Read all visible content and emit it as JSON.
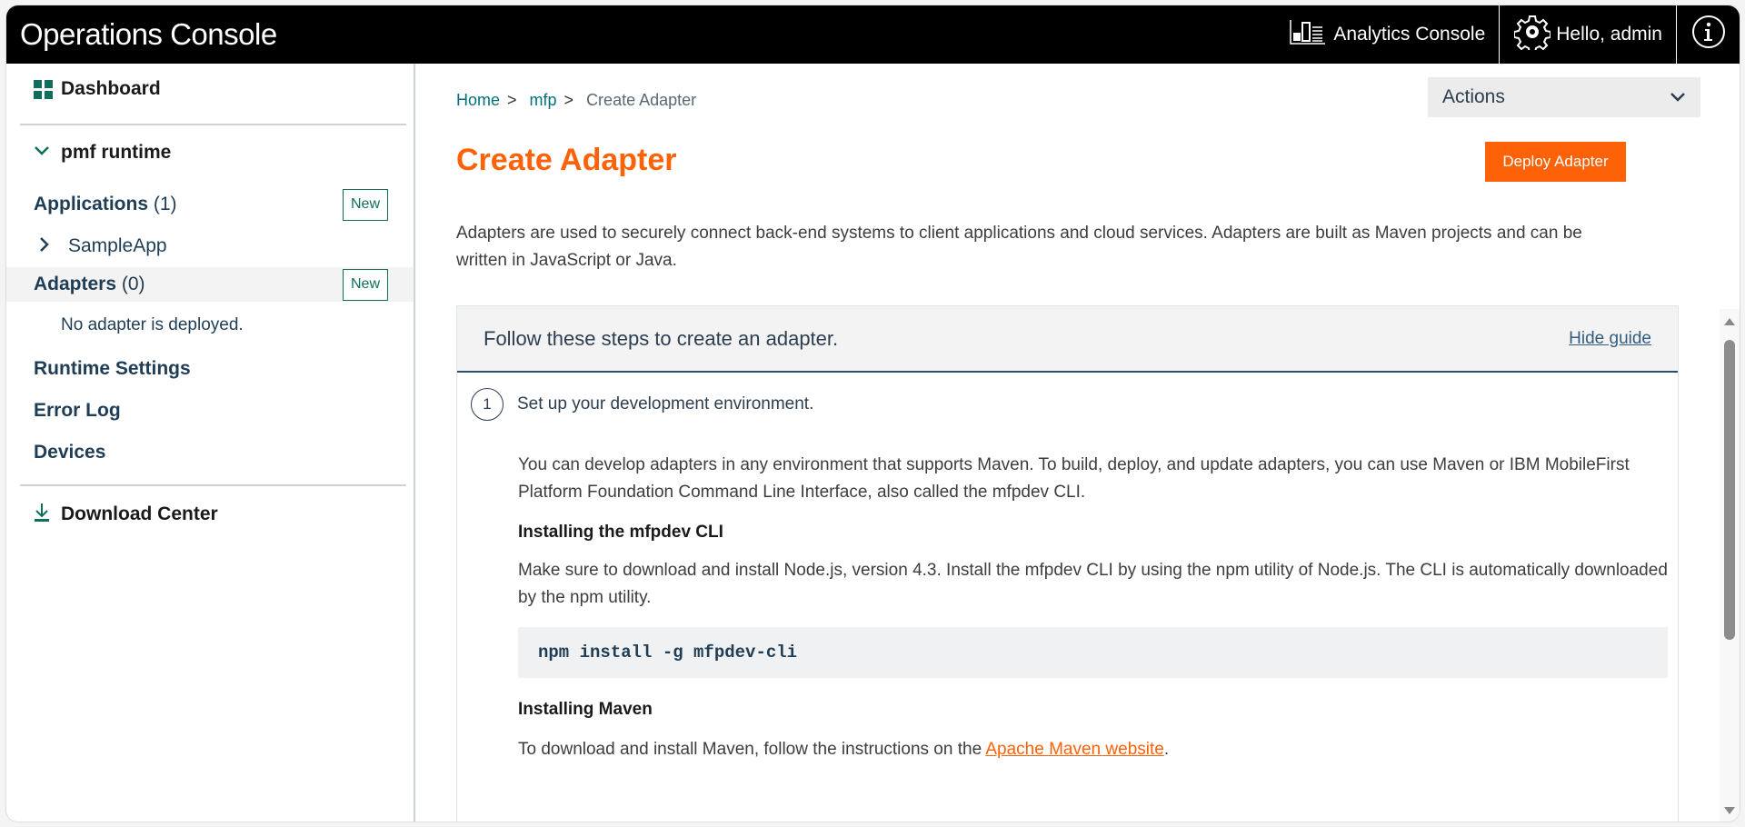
{
  "header": {
    "app_title": "Operations Console",
    "analytics_label": "Analytics Console",
    "user_label": "Hello, admin",
    "icons": {
      "analytics": "bar-chart-icon",
      "settings": "gear-icon",
      "info": "info-icon"
    }
  },
  "sidebar": {
    "dashboard": "Dashboard",
    "runtime": "pmf runtime",
    "applications": {
      "label": "Applications",
      "count": "(1)",
      "new": "New"
    },
    "app_item": "SampleApp",
    "adapters": {
      "label": "Adapters",
      "count": "(0)",
      "new": "New"
    },
    "no_adapter": "No adapter is deployed.",
    "runtime_settings": "Runtime Settings",
    "error_log": "Error Log",
    "devices": "Devices",
    "download_center": "Download Center"
  },
  "main": {
    "breadcrumb": [
      {
        "label": "Home"
      },
      {
        "label": "mfp"
      },
      {
        "label": "Create Adapter"
      }
    ],
    "breadcrumb_sep": ">",
    "actions_label": "Actions",
    "title": "Create Adapter",
    "deploy_button": "Deploy Adapter",
    "description": "Adapters are used to securely connect back-end systems to client applications and cloud services. Adapters are built as Maven projects and can be written in JavaScript or Java.",
    "guide": {
      "title": "Follow these steps to create an adapter.",
      "hide_label": "Hide guide",
      "step": {
        "number": "1",
        "label": "Set up your development environment.",
        "intro": "You can develop adapters in any environment that supports Maven. To build, deploy, and update adapters, you can use Maven or IBM MobileFirst Platform Foundation Command Line Interface, also called the mfpdev CLI.",
        "cli_heading": "Installing the mfpdev CLI",
        "cli_text": "Make sure to download and install Node.js, version 4.3. Install the mfpdev CLI by using the npm utility of Node.js. The CLI is automatically downloaded by the npm utility.",
        "cli_command": "npm install -g mfpdev-cli",
        "maven_heading": "Installing Maven",
        "maven_text_before": "To download and install Maven, follow the instructions on the ",
        "maven_link": "Apache Maven website",
        "maven_text_after": "."
      }
    }
  },
  "colors": {
    "accent": "#fd6208",
    "brand_green": "#0f6e5c",
    "header_bg": "#000000",
    "link_teal": "#00717a"
  }
}
